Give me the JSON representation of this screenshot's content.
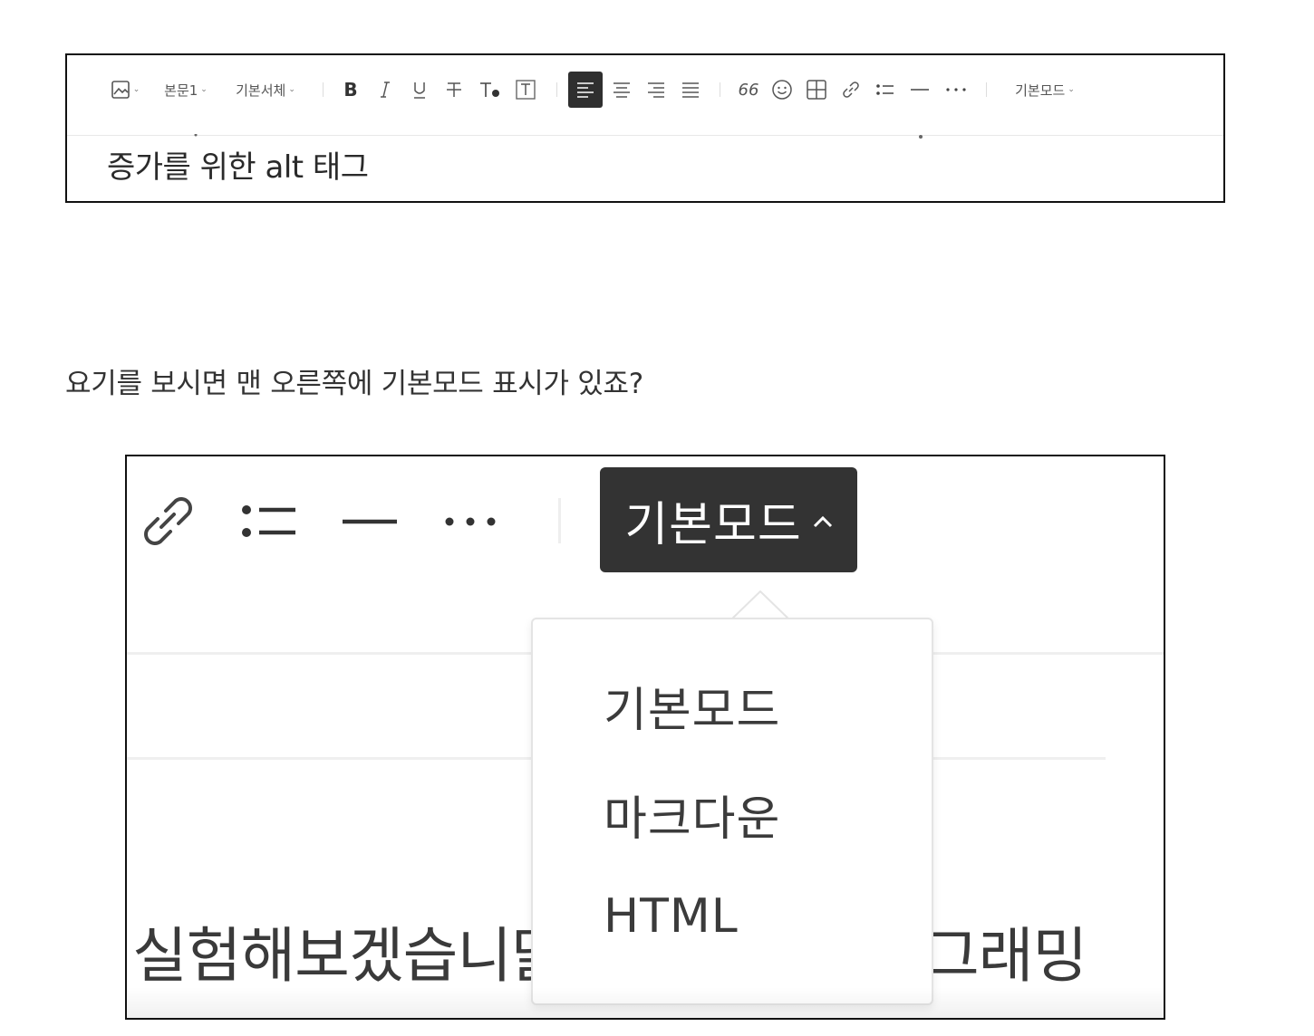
{
  "editor": {
    "toolbar": {
      "image_icon": "image-icon",
      "paragraph_style": "본문1",
      "font_family": "기본서체",
      "bold_label": "B",
      "quote_label": "66",
      "mode_label": "기본모드"
    },
    "content_text": "증가를 위한 alt 태그"
  },
  "caption": "요기를 보시면 맨 오른쪽에 기본모드 표시가 있죠?",
  "zoom": {
    "mode_button_label": "기본모드",
    "mode_options": [
      "기본모드",
      "마크다운",
      "HTML"
    ],
    "body_text_left": "실험해보겠습니닭",
    "body_text_right": "그래밍"
  },
  "colors": {
    "active_bg": "#333333",
    "border": "#111111"
  }
}
